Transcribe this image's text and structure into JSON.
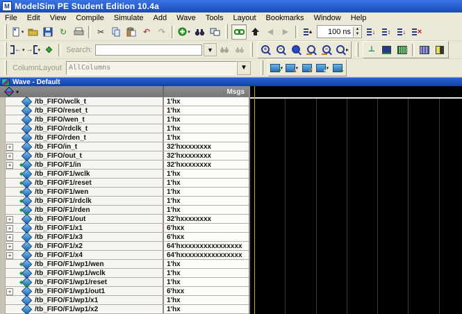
{
  "window": {
    "title": "ModelSim PE Student Edition 10.4a",
    "app_icon_letter": "M"
  },
  "menu": [
    "File",
    "Edit",
    "View",
    "Compile",
    "Simulate",
    "Add",
    "Wave",
    "Tools",
    "Layout",
    "Bookmarks",
    "Window",
    "Help"
  ],
  "toolbar": {
    "run_length": "100 ns",
    "search_label": "Search:",
    "search_value": "",
    "column_layout_label": "ColumnLayout",
    "column_layout_value": "AllColumns"
  },
  "icons": {
    "cut": "✂",
    "undo": "↶",
    "redo": "↷",
    "reload": "↻",
    "caret": "▾",
    "dropdown": "▼",
    "spin_up": "▲",
    "spin_down": "▼",
    "nav_left": "◀",
    "nav_right": "▶",
    "run": "↓",
    "run_all": "↕",
    "continue_run": "↓",
    "break_x": "×",
    "arrow_left": "←",
    "arrow_right": "→",
    "zoom_plus": "+",
    "zoom_minus": "−",
    "wave_edge": "⊥",
    "expand": "+",
    "header_caret": "▾",
    "mini_down": "▾",
    "mini_up": "▴",
    "mini_right": "▸",
    "mini_swap": "↺"
  },
  "wave_panel": {
    "title": "Wave - Default",
    "msgs_header": "Msgs",
    "gridline_xs": [
      50,
      95,
      139,
      183,
      227,
      272
    ],
    "cursor_color": "#b8a41e",
    "background": "#000000"
  },
  "signals": [
    {
      "name": "/tb_FIFO/wclk_t",
      "value": "1'hx",
      "expandable": false,
      "icon": "sig"
    },
    {
      "name": "/tb_FIFO/reset_t",
      "value": "1'hx",
      "expandable": false,
      "icon": "sig"
    },
    {
      "name": "/tb_FIFO/wen_t",
      "value": "1'hx",
      "expandable": false,
      "icon": "sig"
    },
    {
      "name": "/tb_FIFO/rdclk_t",
      "value": "1'hx",
      "expandable": false,
      "icon": "sig"
    },
    {
      "name": "/tb_FIFO/rden_t",
      "value": "1'hx",
      "expandable": false,
      "icon": "sig"
    },
    {
      "name": "/tb_FIFO/in_t",
      "value": "32'hxxxxxxxx",
      "expandable": true,
      "icon": "sig"
    },
    {
      "name": "/tb_FIFO/out_t",
      "value": "32'hxxxxxxxx",
      "expandable": true,
      "icon": "sig"
    },
    {
      "name": "/tb_FIFO/F1/in",
      "value": "32'hxxxxxxxx",
      "expandable": true,
      "icon": "in"
    },
    {
      "name": "/tb_FIFO/F1/wclk",
      "value": "1'hx",
      "expandable": false,
      "icon": "in"
    },
    {
      "name": "/tb_FIFO/F1/reset",
      "value": "1'hx",
      "expandable": false,
      "icon": "in"
    },
    {
      "name": "/tb_FIFO/F1/wen",
      "value": "1'hx",
      "expandable": false,
      "icon": "in"
    },
    {
      "name": "/tb_FIFO/F1/rdclk",
      "value": "1'hx",
      "expandable": false,
      "icon": "in"
    },
    {
      "name": "/tb_FIFO/F1/rden",
      "value": "1'hx",
      "expandable": false,
      "icon": "in"
    },
    {
      "name": "/tb_FIFO/F1/out",
      "value": "32'hxxxxxxxx",
      "expandable": true,
      "icon": "out"
    },
    {
      "name": "/tb_FIFO/F1/x1",
      "value": "6'hxx",
      "expandable": true,
      "icon": "sig"
    },
    {
      "name": "/tb_FIFO/F1/x3",
      "value": "6'hxx",
      "expandable": true,
      "icon": "sig"
    },
    {
      "name": "/tb_FIFO/F1/x2",
      "value": "64'hxxxxxxxxxxxxxxxx",
      "expandable": true,
      "icon": "sig"
    },
    {
      "name": "/tb_FIFO/F1/x4",
      "value": "64'hxxxxxxxxxxxxxxxx",
      "expandable": true,
      "icon": "sig"
    },
    {
      "name": "/tb_FIFO/F1/wp1/wen",
      "value": "1'hx",
      "expandable": false,
      "icon": "in"
    },
    {
      "name": "/tb_FIFO/F1/wp1/wclk",
      "value": "1'hx",
      "expandable": false,
      "icon": "in"
    },
    {
      "name": "/tb_FIFO/F1/wp1/reset",
      "value": "1'hx",
      "expandable": false,
      "icon": "in"
    },
    {
      "name": "/tb_FIFO/F1/wp1/out1",
      "value": "6'hxx",
      "expandable": true,
      "icon": "out"
    },
    {
      "name": "/tb_FIFO/F1/wp1/x1",
      "value": "1'hx",
      "expandable": false,
      "icon": "sig"
    },
    {
      "name": "/tb_FIFO/F1/wp1/x2",
      "value": "1'hx",
      "expandable": false,
      "icon": "sig"
    }
  ]
}
